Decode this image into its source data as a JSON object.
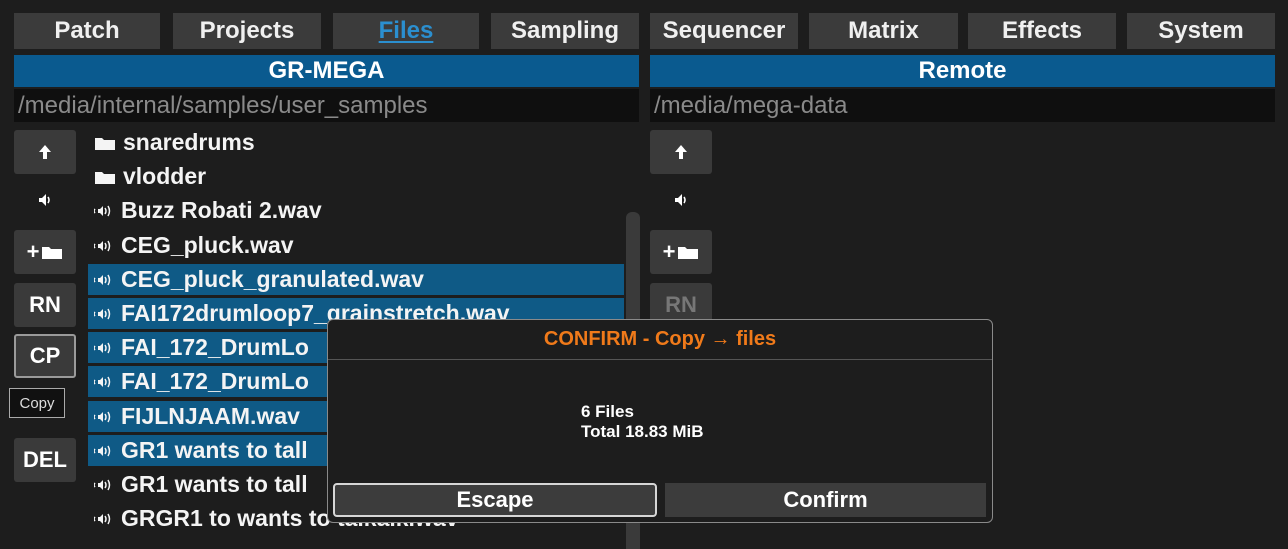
{
  "tabs": [
    "Patch",
    "Projects",
    "Files",
    "Sampling",
    "Sequencer",
    "Matrix",
    "Effects",
    "System"
  ],
  "active_tab": "Files",
  "left_pane": {
    "title": "GR-MEGA",
    "path": "/media/internal/samples/user_samples",
    "buttons": {
      "up": "↑",
      "preview": "◂)",
      "new_folder": "+",
      "rename": "RN",
      "copy": "CP",
      "delete": "DEL"
    },
    "tooltip": "Copy",
    "items": [
      {
        "name": "snaredrums",
        "type": "folder",
        "selected": false
      },
      {
        "name": "vlodder",
        "type": "folder",
        "selected": false
      },
      {
        "name": "Buzz Robati 2.wav",
        "type": "audio",
        "selected": false
      },
      {
        "name": "CEG_pluck.wav",
        "type": "audio",
        "selected": false
      },
      {
        "name": "CEG_pluck_granulated.wav",
        "type": "audio",
        "selected": true
      },
      {
        "name": "FAI172drumloop7_grainstretch.wav",
        "type": "audio",
        "selected": true
      },
      {
        "name": "FAI_172_DrumLo",
        "type": "audio",
        "selected": true
      },
      {
        "name": "FAI_172_DrumLo",
        "type": "audio",
        "selected": true
      },
      {
        "name": "FIJLNJAAM.wav",
        "type": "audio",
        "selected": true
      },
      {
        "name": "GR1 wants to tall",
        "type": "audio",
        "selected": true
      },
      {
        "name": "GR1 wants to tall",
        "type": "audio",
        "selected": false
      },
      {
        "name": "GRGR1 to wants to talkalk.wav",
        "type": "audio",
        "selected": false
      }
    ]
  },
  "right_pane": {
    "title": "Remote",
    "path": "/media/mega-data",
    "buttons": {
      "up": "↑",
      "preview": "◂)",
      "new_folder": "+",
      "rename": "RN"
    }
  },
  "dialog": {
    "title": "CONFIRM - Copy → files",
    "line1": "6 Files",
    "line2": "Total 18.83 MiB",
    "escape_label": "Escape",
    "confirm_label": "Confirm"
  },
  "colors": {
    "accent": "#0a5a8f",
    "selection": "#0f5a86",
    "warning": "#f07a1a",
    "active_tab_text": "#2b8fcf"
  }
}
